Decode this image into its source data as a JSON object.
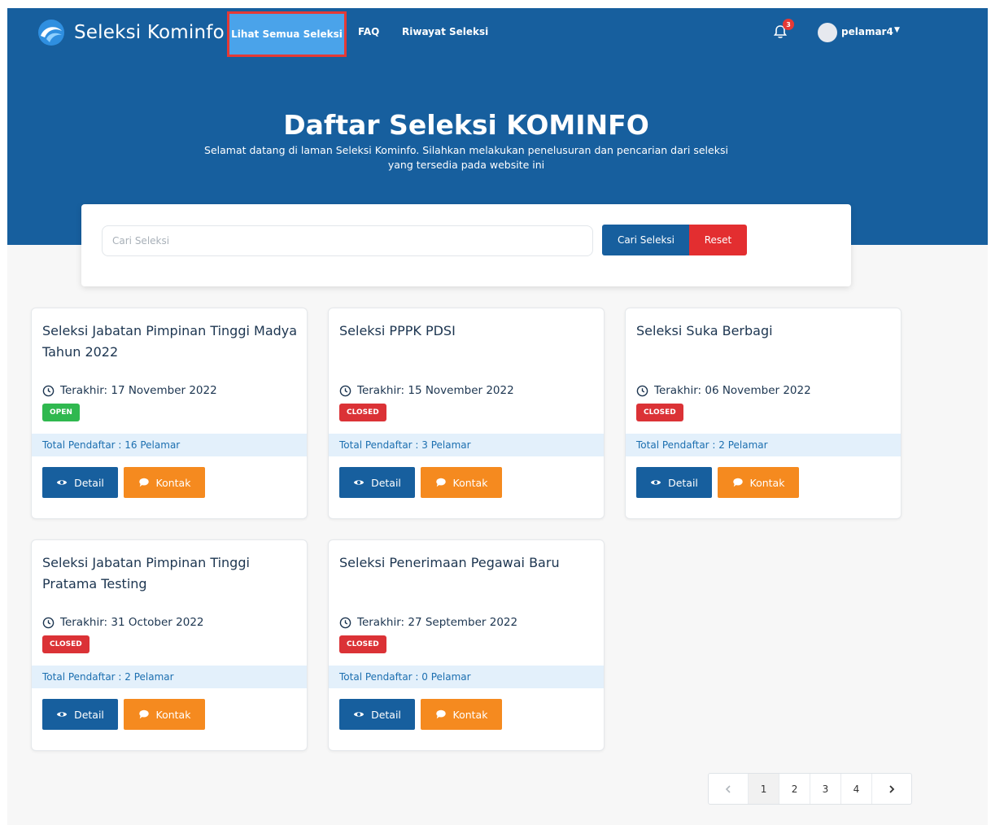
{
  "navbar": {
    "brand": "Seleksi Kominfo",
    "links": [
      "Lihat Semua Seleksi",
      "FAQ",
      "Riwayat Seleksi"
    ],
    "notification_count": "3",
    "user": "pelamar4"
  },
  "hero": {
    "title": "Daftar Seleksi KOMINFO",
    "subtitle": "Selamat datang di laman Seleksi Kominfo. Silahkan melakukan penelusuran dan pencarian dari seleksi yang tersedia pada website ini"
  },
  "search": {
    "placeholder": "Cari Seleksi",
    "value": "",
    "search_button": "Cari Seleksi",
    "reset_button": "Reset"
  },
  "cards": [
    {
      "title": "Seleksi Jabatan Pimpinan Tinggi Madya Tahun 2022",
      "deadline": "Terakhir: 17 November 2022",
      "status": "OPEN",
      "total": "Total Pendaftar : 16 Pelamar",
      "detail_label": "Detail",
      "kontak_label": "Kontak"
    },
    {
      "title": "Seleksi PPPK PDSI",
      "deadline": "Terakhir: 15 November 2022",
      "status": "CLOSED",
      "total": "Total Pendaftar : 3 Pelamar",
      "detail_label": "Detail",
      "kontak_label": "Kontak"
    },
    {
      "title": "Seleksi Suka Berbagi",
      "deadline": "Terakhir: 06 November 2022",
      "status": "CLOSED",
      "total": "Total Pendaftar : 2 Pelamar",
      "detail_label": "Detail",
      "kontak_label": "Kontak"
    },
    {
      "title": "Seleksi Jabatan Pimpinan Tinggi Pratama Testing",
      "deadline": "Terakhir: 31 October 2022",
      "status": "CLOSED",
      "total": "Total Pendaftar : 2 Pelamar",
      "detail_label": "Detail",
      "kontak_label": "Kontak"
    },
    {
      "title": "Seleksi Penerimaan Pegawai Baru",
      "deadline": "Terakhir: 27 September 2022",
      "status": "CLOSED",
      "total": "Total Pendaftar : 0 Pelamar",
      "detail_label": "Detail",
      "kontak_label": "Kontak"
    }
  ],
  "pagination": {
    "pages": [
      "1",
      "2",
      "3",
      "4"
    ],
    "current": "1"
  },
  "colors": {
    "primary": "#175f9e",
    "nav_active": "#4aa3ea",
    "open": "#2fb84f",
    "closed": "#db3236",
    "kontak": "#f58a1f",
    "reset": "#e32e30"
  }
}
